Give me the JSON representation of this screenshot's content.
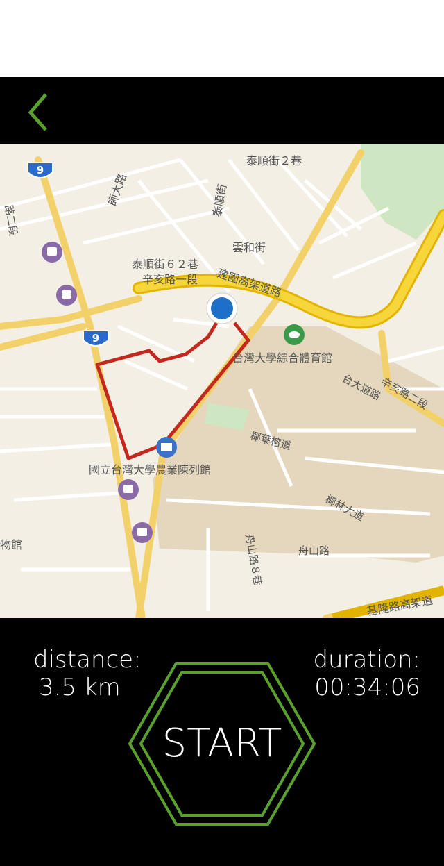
{
  "nav": {
    "back_icon": "chevron-left-icon",
    "accent": "#5aa02c"
  },
  "map": {
    "route_color": "#c3281e",
    "labels": {
      "l1": "泰順街２巷",
      "l2": "師大路",
      "l3": "泰順街",
      "l4": "泰順街６２巷",
      "l5": "雲和街",
      "l6": "辛亥路一段",
      "l7": "建國高架道路",
      "l8": "台灣大學綜合體育館",
      "l9": "台大道路",
      "l10": "辛亥路二段",
      "l11": "椰葉榕道",
      "l12": "國立台灣大學農業陳列館",
      "l13": "椰林大道",
      "l14": "舟山路",
      "l15": "舟山路８巷",
      "l16": "物館",
      "l17": "基隆路高架道",
      "l18": "路二段"
    },
    "shields": {
      "s1": "9",
      "s2": "9"
    }
  },
  "stats": {
    "distance_label": "distance:",
    "distance_value": "3.5 km",
    "duration_label": "duration:",
    "duration_value": "00:34:06"
  },
  "start": {
    "label": "START",
    "accent": "#5aa02c"
  }
}
